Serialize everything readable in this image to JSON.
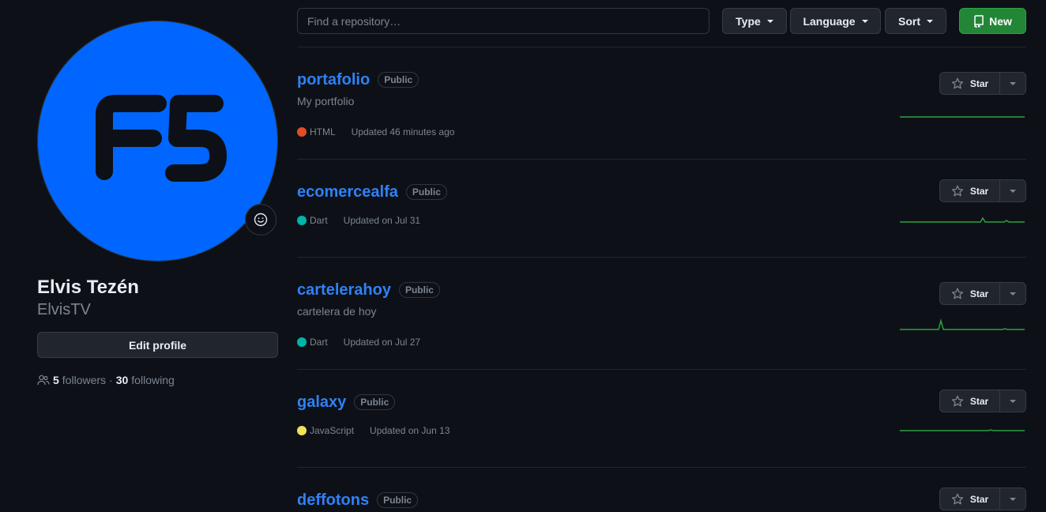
{
  "profile": {
    "avatar_text": "F5",
    "avatar_color": "#0066ff",
    "full_name": "Elvis Tezén",
    "username": "ElvisTV",
    "edit_label": "Edit profile",
    "followers_count": "5",
    "followers_label": "followers",
    "separator": "·",
    "following_count": "30",
    "following_label": "following"
  },
  "toolbar": {
    "search_placeholder": "Find a repository…",
    "type_label": "Type",
    "language_label": "Language",
    "sort_label": "Sort",
    "new_label": "New"
  },
  "repos": [
    {
      "name": "portafolio",
      "visibility": "Public",
      "description": "My portfolio",
      "language": "HTML",
      "language_color": "#e34c26",
      "updated": "Updated 46 minutes ago",
      "star_label": "Star"
    },
    {
      "name": "ecomercealfa",
      "visibility": "Public",
      "description": "",
      "language": "Dart",
      "language_color": "#00b4ab",
      "updated": "Updated on Jul 31",
      "star_label": "Star"
    },
    {
      "name": "carteleraho y",
      "visibility": "Public",
      "description": "cartelera de hoy",
      "language": "Dart",
      "language_color": "#00b4ab",
      "updated": "Updated on Jul 27",
      "star_label": "Star"
    },
    {
      "name": "galaxy",
      "visibility": "Public",
      "description": "",
      "language": "JavaScript",
      "language_color": "#f1e05a",
      "updated": "Updated on Jun 13",
      "star_label": "Star"
    },
    {
      "name": "deffotons",
      "visibility": "Public",
      "description": "",
      "language": "",
      "language_color": "",
      "updated": "",
      "star_label": "Star"
    }
  ],
  "colors": {
    "accent_link": "#2f81f7",
    "new_button": "#238636",
    "sparkline": "#2ea043"
  }
}
